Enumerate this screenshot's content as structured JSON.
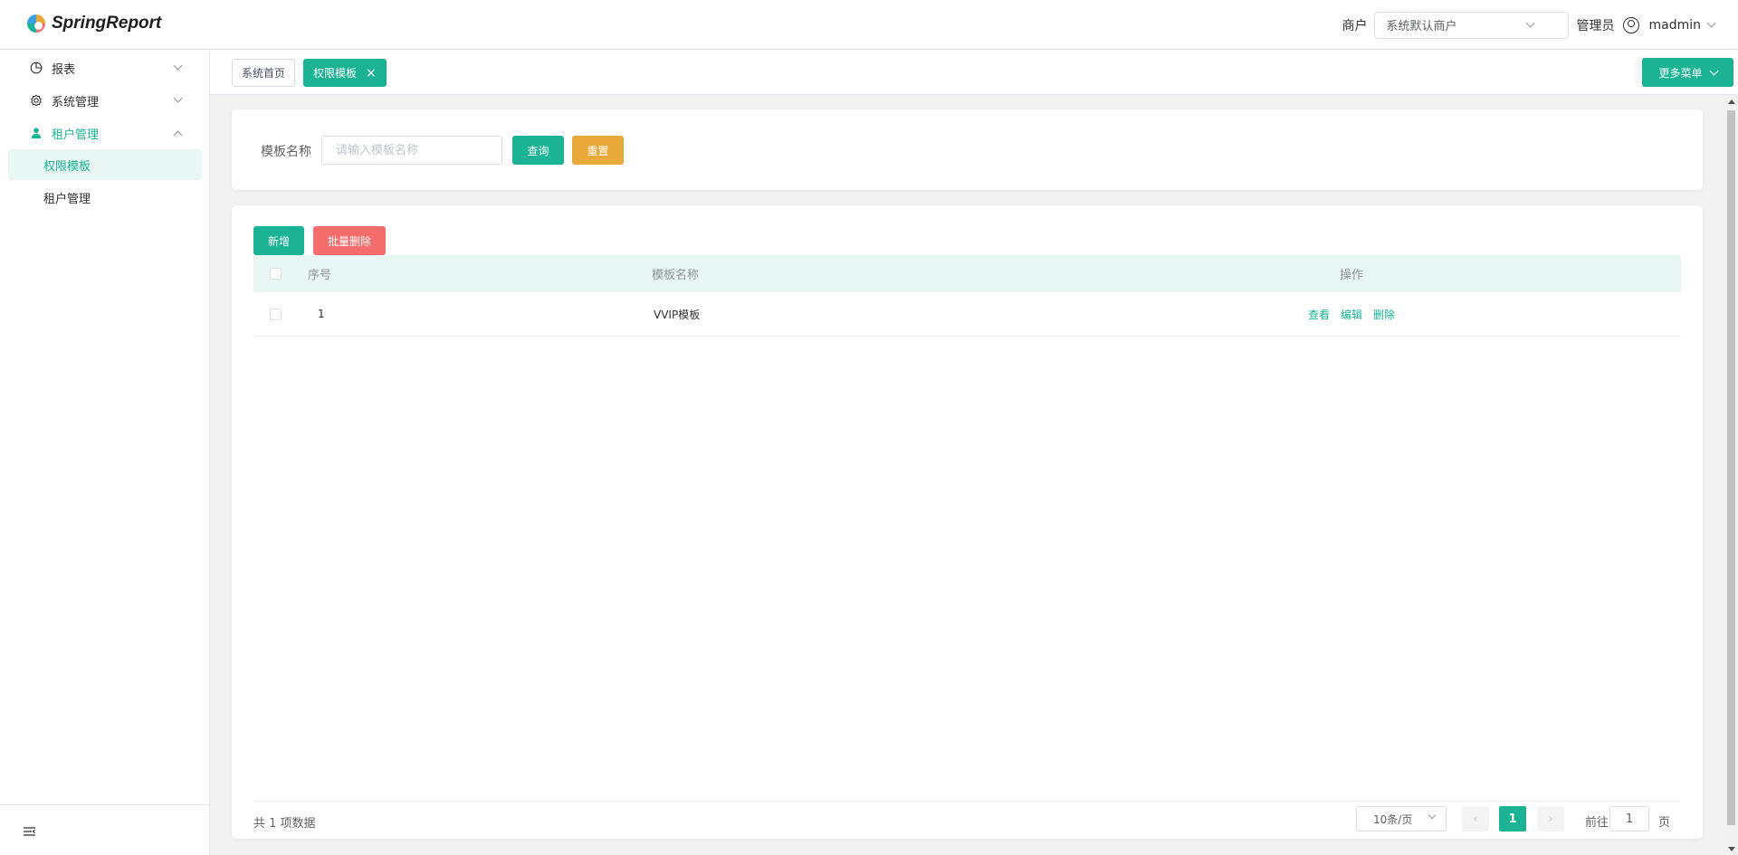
{
  "app": {
    "logo_text": "SpringReport"
  },
  "header": {
    "tenant_label": "商户",
    "tenant_value": "系统默认商户",
    "role_label": "管理员",
    "username": "madmin"
  },
  "sidebar": {
    "items": [
      {
        "label": "报表",
        "icon": "pie-chart-icon",
        "expanded": false
      },
      {
        "label": "系统管理",
        "icon": "gear-icon",
        "expanded": false
      },
      {
        "label": "租户管理",
        "icon": "user-icon",
        "expanded": true
      }
    ],
    "sub_items": [
      {
        "label": "权限模板",
        "active": true
      },
      {
        "label": "租户管理",
        "active": false
      }
    ]
  },
  "tabs": [
    {
      "label": "系统首页",
      "active": false
    },
    {
      "label": "权限模板",
      "active": true,
      "close": "×"
    }
  ],
  "more_menu_label": "更多菜单",
  "search": {
    "label": "模板名称",
    "placeholder": "请输入模板名称",
    "query_label": "查询",
    "reset_label": "重置"
  },
  "toolbar": {
    "add_label": "新增",
    "batch_delete_label": "批量删除"
  },
  "table": {
    "columns": [
      "序号",
      "模板名称",
      "操作"
    ],
    "rows": [
      {
        "no": "1",
        "name": "VVIP模板",
        "actions": [
          "查看",
          "编辑",
          "删除"
        ]
      }
    ]
  },
  "pagination": {
    "total_text": "共 1 项数据",
    "page_size": "10条/页",
    "current_page": "1",
    "goto_label": "前往",
    "goto_value": "1",
    "goto_suffix": "页",
    "prev": "‹",
    "next": "›"
  },
  "colors": {
    "primary": "#1bb394",
    "warning": "#e8a93a",
    "danger": "#f56c6c"
  }
}
